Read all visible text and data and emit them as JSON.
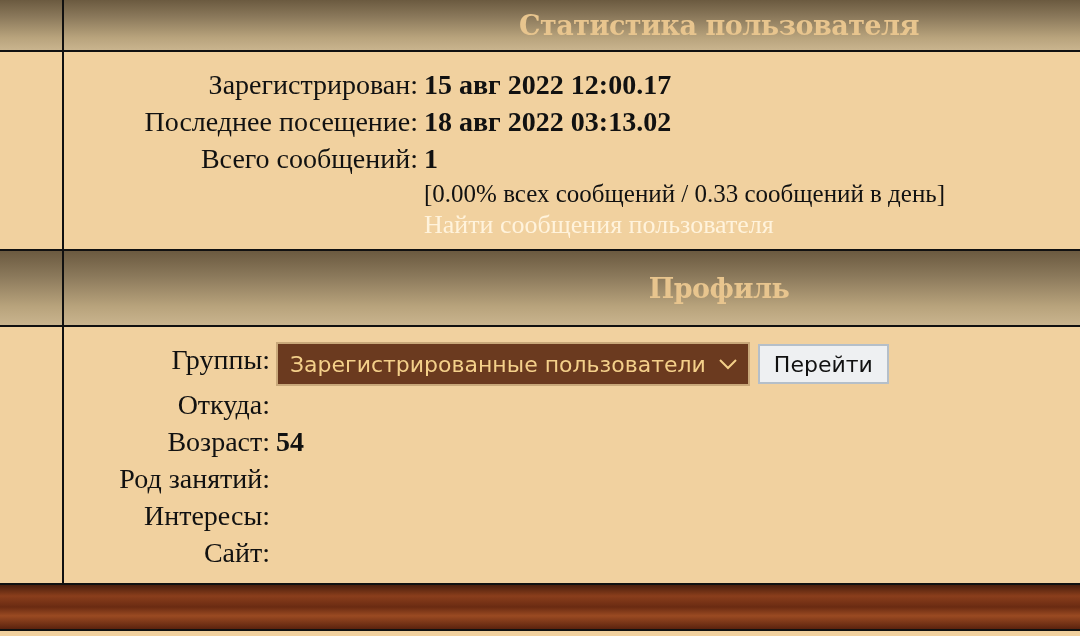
{
  "sections": [
    {
      "title": "Статистика пользователя",
      "rows": [
        {
          "kind": "text",
          "label": "Зарегистрирован:",
          "value": "15 авг 2022 12:00.17"
        },
        {
          "kind": "text",
          "label": "Последнее посещение:",
          "value": "18 авг 2022 03:13.02"
        },
        {
          "kind": "text",
          "label": "Всего сообщений:",
          "value": "1",
          "note": "[0.00% всех сообщений / 0.33 сообщений в день]",
          "link": "Найти сообщения пользователя"
        }
      ]
    },
    {
      "title": "Профиль",
      "rows": [
        {
          "kind": "select",
          "label": "Группы:",
          "value": "Зарегистрированные пользователи",
          "button": "Перейти"
        },
        {
          "kind": "text",
          "label": "Откуда:"
        },
        {
          "kind": "text",
          "label": "Возраст:",
          "value": "54"
        },
        {
          "kind": "text",
          "label": "Род занятий:"
        },
        {
          "kind": "text",
          "label": "Интересы:"
        },
        {
          "kind": "text",
          "label": "Сайт:"
        }
      ]
    }
  ]
}
